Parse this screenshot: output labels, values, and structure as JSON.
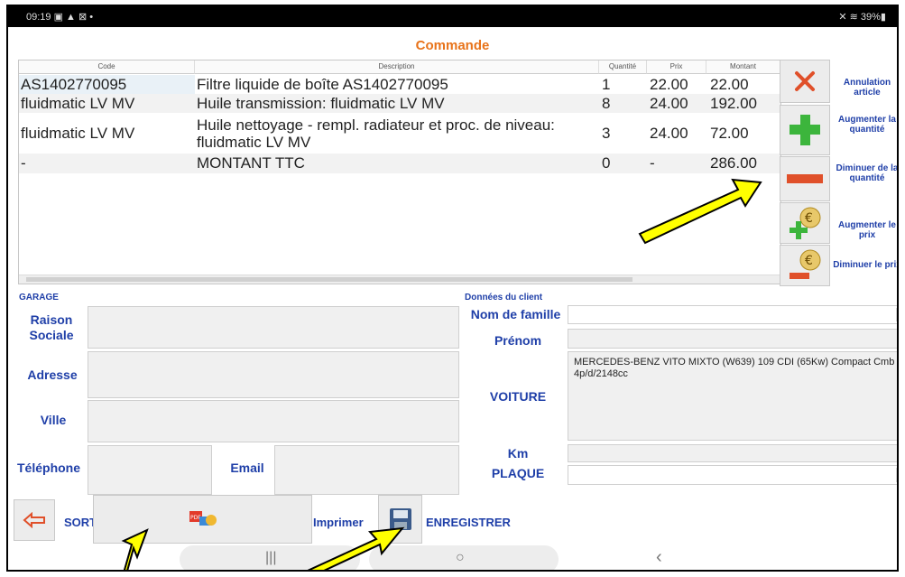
{
  "status_bar": {
    "time": "09:19",
    "left_icons": "▣ ▲ ⊠ •",
    "right_icons": "✕ ≋ 39%▮"
  },
  "title": "Commande",
  "table": {
    "headers": [
      "Code",
      "Description",
      "Quantité",
      "Prix",
      "Montant"
    ],
    "rows": [
      {
        "code": "AS1402770095",
        "description": "Filtre liquide de boîte AS1402770095",
        "quantite": "1",
        "prix": "22.00",
        "montant": "22.00"
      },
      {
        "code": "fluidmatic LV MV",
        "description": "Huile transmission: fluidmatic LV MV",
        "quantite": "8",
        "prix": "24.00",
        "montant": "192.00"
      },
      {
        "code": "fluidmatic LV MV",
        "description": "Huile nettoyage - rempl. radiateur et proc. de niveau: fluidmatic LV MV",
        "quantite": "3",
        "prix": "24.00",
        "montant": "72.00"
      },
      {
        "code": "-",
        "description": "MONTANT TTC",
        "quantite": "0",
        "prix": "-",
        "montant": "286.00"
      }
    ]
  },
  "side_actions": {
    "cancel": "Annulation article",
    "increase_qty": "Augmenter la quantité",
    "decrease_qty": "Diminuer de la quantité",
    "increase_price": "Augmenter le prix",
    "decrease_price": "Diminuer le prix"
  },
  "garage": {
    "section": "GARAGE",
    "raison_sociale": "Raison Sociale",
    "adresse": "Adresse",
    "ville": "Ville",
    "telephone": "Téléphone",
    "email": "Email"
  },
  "client": {
    "section": "Données du client",
    "nom": "Nom de famille",
    "prenom": "Prénom",
    "voiture_label": "VOITURE",
    "voiture_value": "MERCEDES-BENZ VITO MIXTO (W639) 109 CDI (65Kw) Compact Cmb 4p/d/2148cc",
    "km": "Km",
    "plaque": "PLAQUE"
  },
  "bottom": {
    "sortie": "SORTIE",
    "imprimer": "Imprimer",
    "enregistrer": "ENREGISTRER"
  },
  "nav": {
    "recents": "|||",
    "home": "○",
    "back": "‹"
  },
  "colors": {
    "accent": "#e8731a",
    "label_blue": "#1f3fa8",
    "plus_green": "#3cb53c",
    "minus_red": "#e0502a",
    "arrow_yellow": "#ffff00"
  },
  "icons": [
    "close-icon",
    "plus-icon",
    "minus-icon",
    "euro-plus-icon",
    "euro-minus-icon",
    "back-arrow-icon",
    "pdf-icon",
    "save-icon"
  ]
}
